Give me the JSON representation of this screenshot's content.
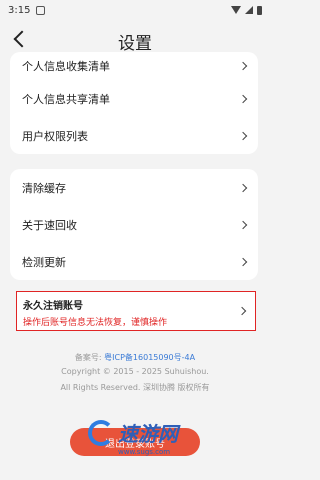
{
  "statusbar": {
    "time": "3:15"
  },
  "header": {
    "title": "设置"
  },
  "group1": [
    {
      "label": "个人信息收集清单"
    },
    {
      "label": "个人信息共享清单"
    },
    {
      "label": "用户权限列表"
    }
  ],
  "group2": [
    {
      "label": "清除缓存"
    },
    {
      "label": "关于速回收"
    },
    {
      "label": "检测更新"
    }
  ],
  "danger": {
    "title": "永久注销账号",
    "warning": "操作后账号信息无法恢复，谨慎操作"
  },
  "footer": {
    "icp_label": "备案号:",
    "icp_value": "粤ICP备16015090号-4A",
    "copyright": "Copyright © 2015 - 2025 Suhuishou.",
    "rights": "All Rights Reserved. 深圳协腾 版权所有"
  },
  "logout": {
    "label": "退出登录账号"
  },
  "watermark": {
    "text": "速游网",
    "url": "www.sugs.com"
  }
}
